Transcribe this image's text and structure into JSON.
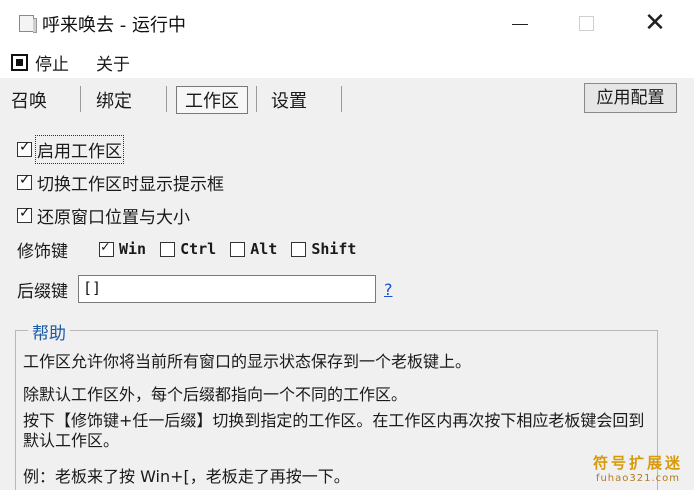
{
  "window": {
    "title": "呼来唤去 - 运行中",
    "minimize_glyph": "—",
    "maximize_glyph": "□",
    "close_glyph": "✕"
  },
  "menu": {
    "stop_label": "停止",
    "about_label": "关于"
  },
  "tabs": [
    {
      "label": "召唤",
      "active": false
    },
    {
      "label": "绑定",
      "active": false
    },
    {
      "label": "工作区",
      "active": true
    },
    {
      "label": "设置",
      "active": false
    }
  ],
  "toolbar": {
    "apply_label": "应用配置"
  },
  "options": {
    "enable_workspace": {
      "label": "启用工作区",
      "checked": true
    },
    "show_tip_on_switch": {
      "label": "切换工作区时显示提示框",
      "checked": true
    },
    "restore_position": {
      "label": "还原窗口位置与大小",
      "checked": true
    }
  },
  "modifiers": {
    "label": "修饰键",
    "items": [
      {
        "label": "Win",
        "checked": true
      },
      {
        "label": "Ctrl",
        "checked": false
      },
      {
        "label": "Alt",
        "checked": false
      },
      {
        "label": "Shift",
        "checked": false
      }
    ]
  },
  "suffix": {
    "label": "后缀键",
    "value": "[]",
    "help_link": "?"
  },
  "help": {
    "title": "帮助",
    "lines": [
      "工作区允许你将当前所有窗口的显示状态保存到一个老板键上。",
      "除默认工作区外，每个后缀都指向一个不同的工作区。",
      "按下【修饰键+任一后缀】切换到指定的工作区。在工作区内再次按下相应老板键会回到默认工作区。",
      "例：老板来了按 Win+[，老板走了再按一下。"
    ]
  },
  "watermark": {
    "main": "符号扩展迷",
    "sub": "fuhao321.com"
  },
  "colors": {
    "panel_bg": "#f0f0f0",
    "link": "#1a4fd0",
    "group_title": "#1a5aa8",
    "watermark": "#d89a0a"
  }
}
